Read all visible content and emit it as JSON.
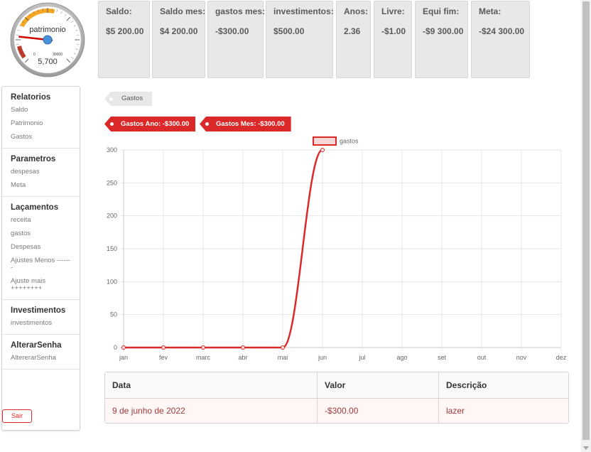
{
  "gauge": {
    "label": "patrimonio",
    "value": "5,700",
    "min_label": "0",
    "max_label": "30000",
    "value_fraction": 0.19,
    "colors": {
      "band_warning": "#f5a623",
      "band_danger": "#c0392b",
      "needle": "#cc0000"
    }
  },
  "stats": [
    {
      "label": "Saldo:",
      "value": "$5 200.00"
    },
    {
      "label": "Saldo mes:",
      "value": "$4 200.00"
    },
    {
      "label": "gastos mes:",
      "value": "-$300.00"
    },
    {
      "label": "investimentos:",
      "value": "$500.00"
    },
    {
      "label": "Anos:",
      "value": "2.36"
    },
    {
      "label": "Livre:",
      "value": "-$1.00"
    },
    {
      "label": "Equi fim:",
      "value": "-$9 300.00"
    },
    {
      "label": "Meta:",
      "value": "-$24 300.00"
    }
  ],
  "sidebar": {
    "sections": [
      {
        "title": "Relatorios",
        "items": [
          "Saldo",
          "Patrimonio",
          "Gastos"
        ]
      },
      {
        "title": "Parametros",
        "items": [
          "despesas",
          "Meta"
        ]
      },
      {
        "title": "Laçamentos",
        "items": [
          "receita",
          "gastos",
          "Despesas",
          "Ajustes Menos -------",
          "Ajuste mais ++++++++"
        ]
      },
      {
        "title": "Investimentos",
        "items": [
          "investimentos"
        ]
      },
      {
        "title": "AlterarSenha",
        "items": [
          "AltererarSenha"
        ]
      }
    ],
    "logout_label": "Sair"
  },
  "page_tag": "Gastos",
  "summary_tags": [
    "Gastos Ano: -$300.00",
    "Gastos Mes: -$300.00"
  ],
  "chart_data": {
    "type": "line",
    "categories": [
      "jan",
      "fev",
      "marc",
      "abr",
      "mai",
      "jun",
      "jul",
      "ago",
      "set",
      "out",
      "nov",
      "dez"
    ],
    "series": [
      {
        "name": "gastos",
        "values": [
          0,
          0,
          0,
          0,
          0,
          300
        ],
        "color": "#db2828"
      }
    ],
    "yticks": [
      0,
      50,
      100,
      150,
      200,
      250,
      300
    ],
    "ylim": [
      0,
      300
    ],
    "grid": true,
    "legend": "top-center"
  },
  "table": {
    "headers": [
      "Data",
      "Valor",
      "Descrição"
    ],
    "rows": [
      [
        "9 de junho de 2022",
        "-$300.00",
        "lazer"
      ]
    ]
  },
  "colors": {
    "accent": "#db2828",
    "card_bg": "#e8e8e8",
    "error_row_bg": "#fff6f6",
    "error_row_text": "#9f3a38"
  }
}
